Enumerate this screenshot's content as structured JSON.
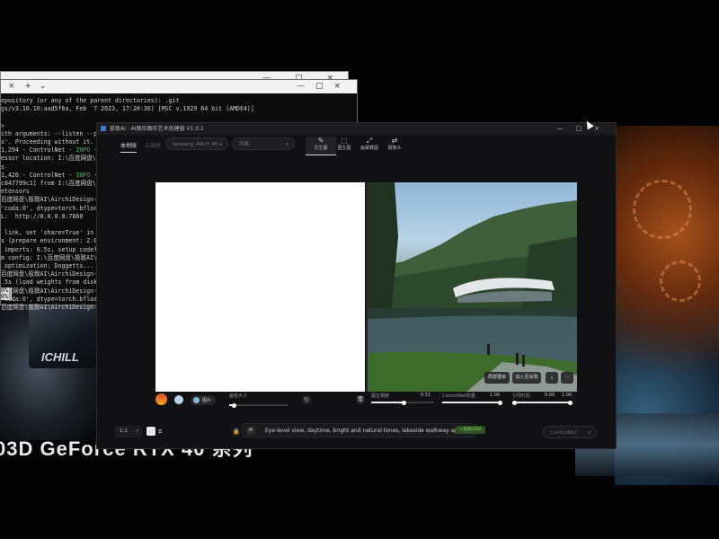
{
  "background": {
    "slogan": "03D GeForce RTX 40 系列",
    "card_brand": "ICHILL",
    "accent_orange": "#b75a1e",
    "accent_blue": "#3a6a8a"
  },
  "terminal": {
    "tab_glyphs": [
      "×",
      "+",
      "⌄"
    ],
    "window_controls": [
      "—",
      "□",
      "×"
    ],
    "lines": [
      "epository (or any of the parent directories): .git",
      "gs/v3.10.10:aad5f6a, Feb  7 2023, 17:20:36) [MSC v.1929 64 bit (AMD64)]",
      "",
      ">",
      "ith arguments: --listen --po",
      "s'. Proceeding without it.",
      "1,294 - ControlNet - INFO - C",
      "essor location: I:\\百度网盘\\",
      "s",
      "1,426 - ControlNet - INFO - C",
      "c847799c1] from I:\\百度网盘\\",
      "etensors",
      "百度网盘\\极致AI\\AirchiDesign-",
      "'cuda:0', dtype=torch.bfloat",
      "L:  http://0.0.0.0:7860",
      "",
      " link, set 'share=True' in '",
      "s (prepare environment: 2.0s",
      " imports: 0.5s, setup codefo",
      "m config: I:\\百度网盘\\极致AI\\",
      " optimization: Doggettx... do",
      "百度网盘\\极致AI\\AirchiDesign-",
      ".5s (load weights from disk:",
      "百度网盘\\极致AI\\AirchiDesign-",
      "'cuda:0', dtype=torch.bfloat",
      "百度网盘\\极致AI\\AirchiDesign-"
    ],
    "progress_lines": [
      "0%|",
      "0%|"
    ]
  },
  "app": {
    "title": "甚致AI · AI图形图形艺术创建窗 V1.0.1",
    "window_controls": [
      "—",
      "□",
      "×"
    ],
    "tabs": [
      {
        "label": "本地版",
        "active": true
      },
      {
        "label": "云端版",
        "active": false
      }
    ],
    "model_select": "laowang_ARCH_MI...",
    "style_select": "风格",
    "modes": [
      {
        "icon": "✎",
        "label": "文生图",
        "active": true
      },
      {
        "icon": "⬚",
        "label": "图生图",
        "active": false
      },
      {
        "icon": "⤢",
        "label": "画幕截图",
        "active": false
      },
      {
        "icon": "⇄",
        "label": "摄像头",
        "active": false
      }
    ],
    "render_buttons": [
      "局部重绘",
      "加入至涂鸦"
    ],
    "controls": {
      "picture_label": "图片",
      "brush_size_label": "画笔大小",
      "brush_size_value": 0.08,
      "creativity_label": "图位相度",
      "creativity_value": "0.51",
      "controlnet_weight_label": "ControlNet权重",
      "controlnet_weight_value": "1.00",
      "guidance_label": "引导时机",
      "guidance_start": "0.00",
      "guidance_end": "1.00"
    },
    "bottom": {
      "ratio": "1:1",
      "prompt": "Eye-level view, daytime, bright and natural tones, lakeside walkway ap...",
      "lora_button": "+添加LORA",
      "controlnet_select": "ControlNet"
    }
  }
}
